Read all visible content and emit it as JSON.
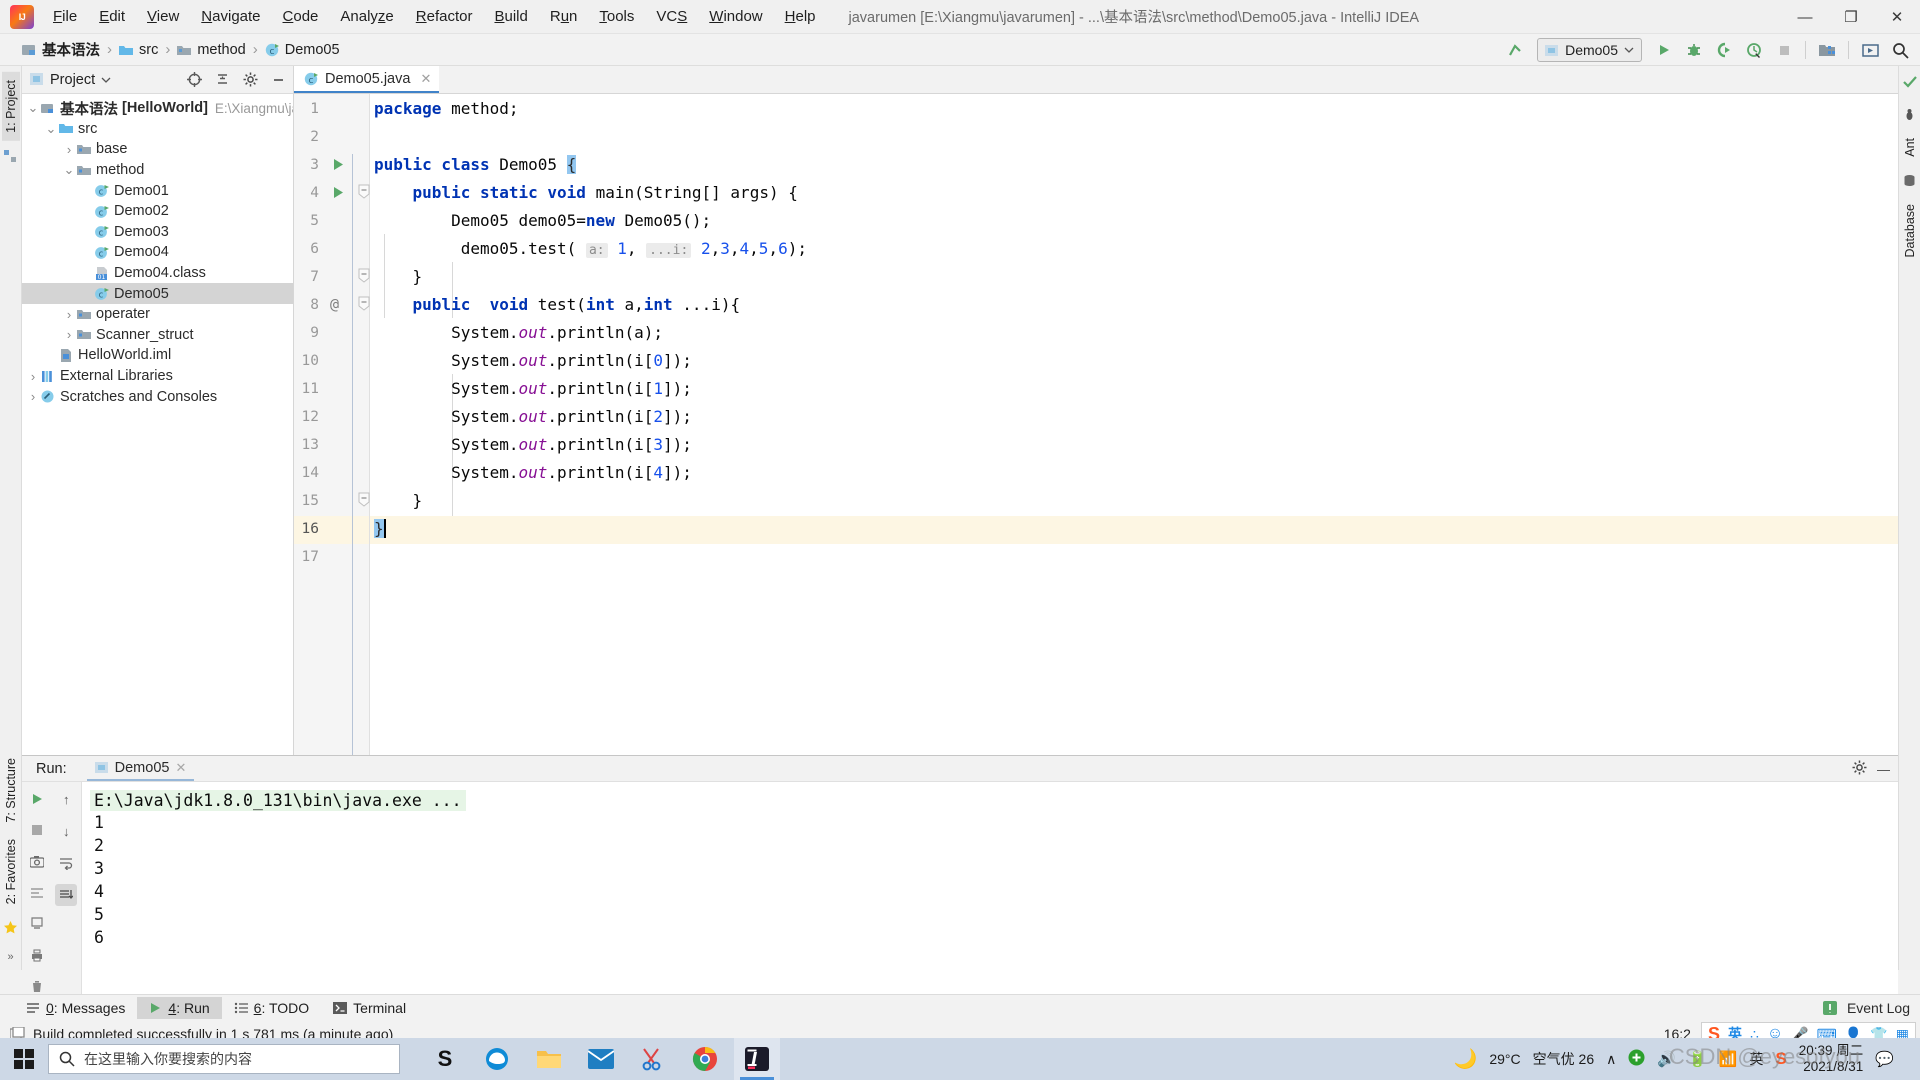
{
  "window": {
    "title": "javarumen [E:\\Xiangmu\\javarumen] - ...\\基本语法\\src\\method\\Demo05.java - IntelliJ IDEA",
    "minimize": "—",
    "maximize": "❐",
    "close": "✕"
  },
  "menu": {
    "items": [
      "File",
      "Edit",
      "View",
      "Navigate",
      "Code",
      "Analyze",
      "Refactor",
      "Build",
      "Run",
      "Tools",
      "VCS",
      "Window",
      "Help"
    ]
  },
  "breadcrumb": {
    "items": [
      {
        "label": "基本语法",
        "icon": "module-icon"
      },
      {
        "label": "src",
        "icon": "source-folder-icon"
      },
      {
        "label": "method",
        "icon": "package-folder-icon"
      },
      {
        "label": "Demo05",
        "icon": "java-class-icon"
      }
    ]
  },
  "toolbar": {
    "back_arrow": "back-arrow-icon",
    "run_config": "Demo05",
    "run": "run-icon",
    "debug": "debug-icon",
    "run_coverage": "run-with-coverage-icon",
    "profiler": "profiler-icon",
    "stop": "stop-icon",
    "project_structure": "project-structure-icon",
    "updates": "updates-icon",
    "search_everywhere": "search-icon"
  },
  "left_strip": {
    "tabs": [
      "1: Project"
    ],
    "bottom_tabs": [
      "2: Favorites",
      "7: Structure"
    ]
  },
  "right_strip": {
    "tabs": [
      "Ant",
      "Database"
    ]
  },
  "project_panel": {
    "title": "Project",
    "icons": [
      "locate-icon",
      "collapse-all-icon",
      "gear-icon",
      "hide-icon"
    ],
    "tree": [
      {
        "label": "基本语法",
        "badge": "[HelloWorld]",
        "sub": "E:\\Xiangmu\\java",
        "indent": 0,
        "arrow": "⌄",
        "icon": "module-icon",
        "bold": true,
        "selected": false
      },
      {
        "label": "src",
        "indent": 1,
        "arrow": "⌄",
        "icon": "source-folder-icon",
        "selected": false
      },
      {
        "label": "base",
        "indent": 2,
        "arrow": "›",
        "icon": "package-folder-icon",
        "selected": false
      },
      {
        "label": "method",
        "indent": 2,
        "arrow": "⌄",
        "icon": "package-folder-icon",
        "selected": false
      },
      {
        "label": "Demo01",
        "indent": 3,
        "arrow": "",
        "icon": "java-class-icon",
        "selected": false
      },
      {
        "label": "Demo02",
        "indent": 3,
        "arrow": "",
        "icon": "java-class-icon",
        "selected": false
      },
      {
        "label": "Demo03",
        "indent": 3,
        "arrow": "",
        "icon": "java-class-icon",
        "selected": false
      },
      {
        "label": "Demo04",
        "indent": 3,
        "arrow": "",
        "icon": "java-class-icon",
        "selected": false
      },
      {
        "label": "Demo04.class",
        "indent": 3,
        "arrow": "",
        "icon": "class-file-icon",
        "selected": false
      },
      {
        "label": "Demo05",
        "indent": 3,
        "arrow": "",
        "icon": "java-class-icon",
        "selected": true
      },
      {
        "label": "operater",
        "indent": 2,
        "arrow": "›",
        "icon": "package-folder-icon",
        "selected": false
      },
      {
        "label": "Scanner_struct",
        "indent": 2,
        "arrow": "›",
        "icon": "package-folder-icon",
        "selected": false
      },
      {
        "label": "HelloWorld.iml",
        "indent": 1,
        "arrow": "",
        "icon": "iml-file-icon",
        "selected": false
      },
      {
        "label": "External Libraries",
        "indent": 0,
        "arrow": "›",
        "icon": "libraries-icon",
        "selected": false
      },
      {
        "label": "Scratches and Consoles",
        "indent": 0,
        "arrow": "›",
        "icon": "scratches-icon",
        "selected": false
      }
    ]
  },
  "editor": {
    "tab": {
      "label": "Demo05.java",
      "close": "✕",
      "icon": "java-class-icon"
    },
    "breadcrumb_bottom": "Demo05",
    "lines": [
      {
        "n": "1",
        "gutter": "",
        "fold": "",
        "html": "<span class=\"kw\">package</span> <span class=\"plain\">method;</span>",
        "hl": false
      },
      {
        "n": "2",
        "gutter": "",
        "fold": "",
        "html": "",
        "hl": false
      },
      {
        "n": "3",
        "gutter": "run",
        "fold": "",
        "html": "<span class=\"kw\">public class</span> <span class=\"plain\">Demo05 </span><span class=\"brace-hl\">{</span>",
        "hl": false
      },
      {
        "n": "4",
        "gutter": "run",
        "fold": "minus",
        "html": "    <span class=\"kw\">public static void</span> <span class=\"plain\">main(String[] args) {</span>",
        "hl": false
      },
      {
        "n": "5",
        "gutter": "",
        "fold": "",
        "html": "        <span class=\"plain\">Demo05 demo05=</span><span class=\"kw\">new</span> <span class=\"plain\">Demo05();</span>",
        "hl": false
      },
      {
        "n": "6",
        "gutter": "",
        "fold": "",
        "html": "         <span class=\"plain\">demo05.test(</span> <span class=\"hint\">a:</span> <span class=\"num\">1</span><span class=\"plain\">,</span> <span class=\"hint\">...i:</span> <span class=\"num\">2</span><span class=\"plain\">,</span><span class=\"num\">3</span><span class=\"plain\">,</span><span class=\"num\">4</span><span class=\"plain\">,</span><span class=\"num\">5</span><span class=\"plain\">,</span><span class=\"num\">6</span><span class=\"plain\">);</span>",
        "hl": false
      },
      {
        "n": "7",
        "gutter": "",
        "fold": "minus",
        "html": "    <span class=\"plain\">}</span>",
        "hl": false
      },
      {
        "n": "8",
        "gutter": "at",
        "fold": "minus",
        "html": "    <span class=\"kw\">public</span>  <span class=\"kw\">void</span> <span class=\"plain\">test(</span><span class=\"kw\">int</span> <span class=\"plain\">a,</span><span class=\"kw\">int</span> <span class=\"plain\">...i){</span>",
        "hl": false
      },
      {
        "n": "9",
        "gutter": "",
        "fold": "",
        "html": "        <span class=\"plain\">System.</span><span class=\"fld\">out</span><span class=\"plain\">.println(a);</span>",
        "hl": false
      },
      {
        "n": "10",
        "gutter": "",
        "fold": "",
        "html": "        <span class=\"plain\">System.</span><span class=\"fld\">out</span><span class=\"plain\">.println(i[</span><span class=\"num\">0</span><span class=\"plain\">]);</span>",
        "hl": false
      },
      {
        "n": "11",
        "gutter": "",
        "fold": "",
        "html": "        <span class=\"plain\">System.</span><span class=\"fld\">out</span><span class=\"plain\">.println(i[</span><span class=\"num\">1</span><span class=\"plain\">]);</span>",
        "hl": false
      },
      {
        "n": "12",
        "gutter": "",
        "fold": "",
        "html": "        <span class=\"plain\">System.</span><span class=\"fld\">out</span><span class=\"plain\">.println(i[</span><span class=\"num\">2</span><span class=\"plain\">]);</span>",
        "hl": false
      },
      {
        "n": "13",
        "gutter": "",
        "fold": "",
        "html": "        <span class=\"plain\">System.</span><span class=\"fld\">out</span><span class=\"plain\">.println(i[</span><span class=\"num\">3</span><span class=\"plain\">]);</span>",
        "hl": false
      },
      {
        "n": "14",
        "gutter": "",
        "fold": "",
        "html": "        <span class=\"plain\">System.</span><span class=\"fld\">out</span><span class=\"plain\">.println(i[</span><span class=\"num\">4</span><span class=\"plain\">]);</span>",
        "hl": false
      },
      {
        "n": "15",
        "gutter": "",
        "fold": "minus",
        "html": "    <span class=\"plain\">}</span>",
        "hl": false
      },
      {
        "n": "16",
        "gutter": "",
        "fold": "",
        "html": "<span class=\"brace-hl\">}</span><span class=\"caret\"></span>",
        "hl": true
      },
      {
        "n": "17",
        "gutter": "",
        "fold": "",
        "html": "",
        "hl": false
      }
    ]
  },
  "run_window": {
    "label": "Run:",
    "tab": "Demo05",
    "tab_close": "✕",
    "gear": "gear-icon",
    "minimize": "—",
    "side_icons": [
      "rerun-icon",
      "stop-icon",
      "up-arrow-icon",
      "down-arrow-icon",
      "camera-icon",
      "soft-wrap-icon",
      "print-icon",
      "scroll-to-end-icon",
      "trash-icon"
    ],
    "command": "E:\\Java\\jdk1.8.0_131\\bin\\java.exe ...",
    "output": [
      "1",
      "2",
      "3",
      "4",
      "5",
      "6"
    ]
  },
  "bottom_tabs": {
    "items": [
      {
        "num": "0",
        "label": ": Messages",
        "icon": "messages-icon",
        "selected": false
      },
      {
        "num": "4",
        "label": ": Run",
        "icon": "run-icon",
        "selected": true
      },
      {
        "num": "6",
        "label": ": TODO",
        "icon": "todo-icon",
        "selected": false
      },
      {
        "num": "",
        "label": "Terminal",
        "icon": "terminal-icon",
        "selected": false
      }
    ],
    "event_log": "Event Log"
  },
  "status_bar": {
    "message": "Build completed successfully in 1 s 781 ms (a minute ago)",
    "position": "16:2",
    "tray": [
      "搜狗-logo",
      "英",
      "∴",
      "☺",
      "mic-icon",
      "keyboard-icon",
      "user-icon",
      "shirt-icon",
      "apps-icon"
    ]
  },
  "taskbar": {
    "search_placeholder": "在这里输入你要搜索的内容",
    "apps": [
      "sogou-icon",
      "edge-icon",
      "explorer-icon",
      "mail-icon",
      "snip-icon",
      "chrome-icon",
      "intellij-icon"
    ],
    "weather": {
      "temp": "29°C",
      "air": "空气优 26"
    },
    "time": "20:39 周二",
    "date": "2021/8/31",
    "watermark": "CSDN @eyesofyou"
  }
}
